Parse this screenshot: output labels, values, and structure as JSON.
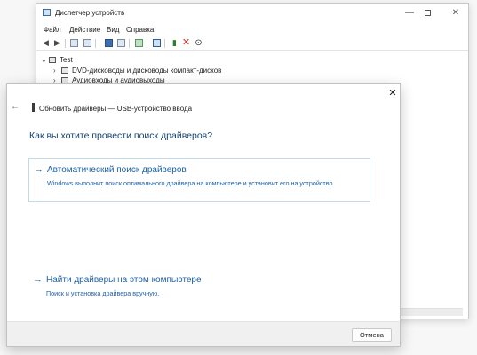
{
  "device_manager": {
    "title": "Диспетчер устройств",
    "controls": {
      "minimize": "—",
      "maximize": "",
      "close": "✕"
    },
    "menu": [
      "Файл",
      "Действие",
      "Вид",
      "Справка"
    ],
    "tree": {
      "root": "Test",
      "items": [
        "DVD-дисководы и дисководы компакт-дисков",
        "Аудиовходы и аудиовыходы"
      ]
    }
  },
  "dialog": {
    "title": "Обновить драйверы — USB-устройство ввода",
    "heading": "Как вы хотите провести поиск драйверов?",
    "option_auto": {
      "title": "Автоматический поиск драйверов",
      "description": "Windows выполнит поиск оптимального драйвера на компьютере и установит его на устройство."
    },
    "option_manual": {
      "title": "Найти драйверы на этом компьютере",
      "description": "Поиск и установка драйвера вручную."
    },
    "cancel_label": "Отмена",
    "close_glyph": "✕",
    "back_glyph": "←",
    "arrow_glyph": "→"
  },
  "colors": {
    "accent": "#1c5fa8",
    "heading": "#16416e",
    "option_border": "#c0dbe6"
  }
}
